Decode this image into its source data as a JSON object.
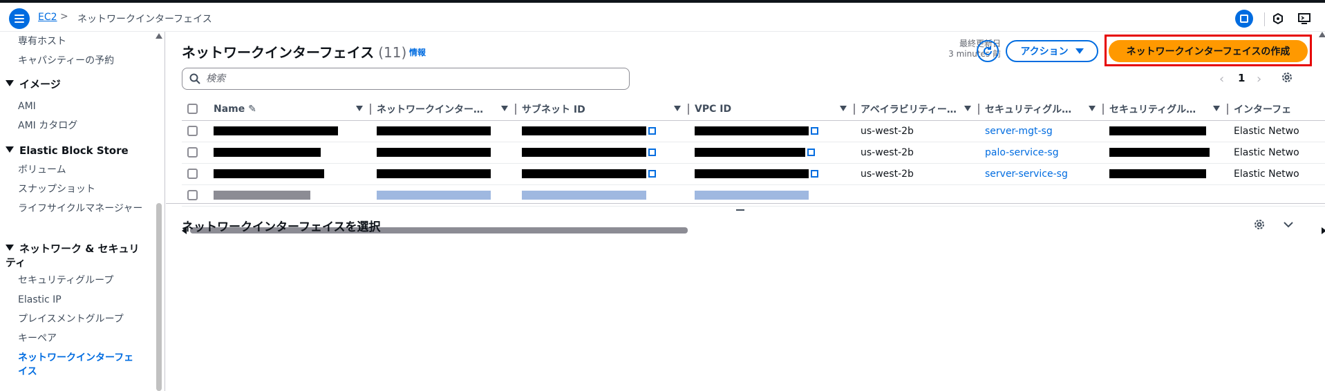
{
  "topbar": {
    "breadcrumb_service": "EC2",
    "breadcrumb_separator": ">",
    "breadcrumb_current": "ネットワークインターフェイス",
    "icons": [
      "cloudshell-icon",
      "notifications-icon",
      "console-icon"
    ]
  },
  "sidebar": {
    "items_top": [
      "専有ホスト",
      "キャパシティーの予約"
    ],
    "section_images": "イメージ",
    "images_items": [
      "AMI",
      "AMI カタログ"
    ],
    "section_ebs": "Elastic Block Store",
    "ebs_items": [
      "ボリューム",
      "スナップショット",
      "ライフサイクルマネージャー"
    ],
    "section_network": "ネットワーク & セキュリティ",
    "network_items": [
      "セキュリティグループ",
      "Elastic IP",
      "プレイスメントグループ",
      "キーペア",
      "ネットワークインターフェイス"
    ]
  },
  "panel": {
    "title": "ネットワークインターフェイス",
    "count": "(11)",
    "info": "情報",
    "last_updated_label": "最終更新日",
    "last_updated_value": "3 minutes 前",
    "action_label": "アクション",
    "create_label": "ネットワークインターフェイスの作成",
    "search_placeholder": "検索",
    "page_number": "1"
  },
  "table": {
    "headers": [
      "Name",
      "ネットワークインター…",
      "サブネット ID",
      "VPC ID",
      "アベイラビリティー…",
      "セキュリティグル…",
      "セキュリティグル…",
      "インターフェ"
    ],
    "rows": [
      {
        "az": "us-west-2b",
        "sg_name": "server-mgt-sg",
        "type": "Elastic Netwo"
      },
      {
        "az": "us-west-2b",
        "sg_name": "palo-service-sg",
        "type": "Elastic Netwo"
      },
      {
        "az": "us-west-2b",
        "sg_name": "server-service-sg",
        "type": "Elastic Netwo"
      }
    ]
  },
  "detail": {
    "title": "ネットワークインターフェイスを選択"
  },
  "colors": {
    "accent": "#006ce0",
    "primary_button": "#ff9900",
    "highlight": "#e60000"
  }
}
